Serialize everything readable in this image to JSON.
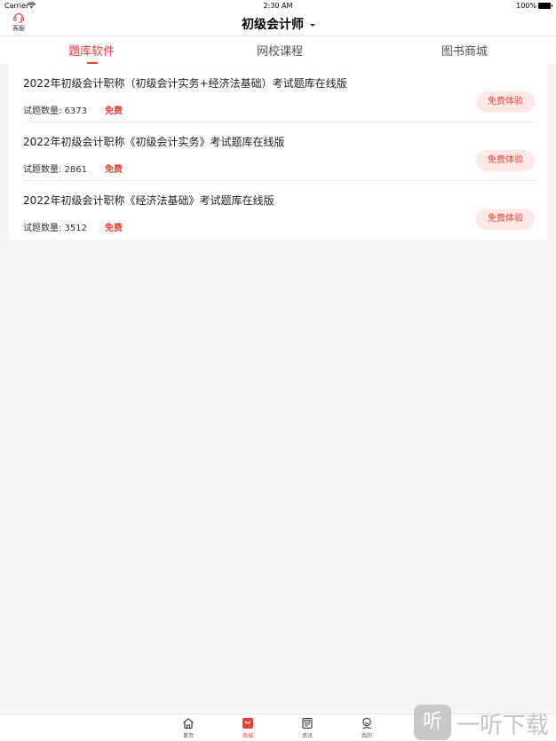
{
  "status_bar": {
    "carrier": "Carrier",
    "time": "2:30 AM",
    "battery": "100%"
  },
  "nav": {
    "service_label": "客服",
    "title": "初级会计师"
  },
  "tabs": [
    {
      "label": "题库软件",
      "active": true
    },
    {
      "label": "网校课程",
      "active": false
    },
    {
      "label": "图书商城",
      "active": false
    }
  ],
  "items": [
    {
      "title": "2022年初级会计职称（初级会计实务+经济法基础）考试题库在线版",
      "count": "试题数量: 6373",
      "free": "免费",
      "button": "免费体验"
    },
    {
      "title": "2022年初级会计职称《初级会计实务》考试题库在线版",
      "count": "试题数量: 2861",
      "free": "免费",
      "button": "免费体验"
    },
    {
      "title": "2022年初级会计职称《经济法基础》考试题库在线版",
      "count": "试题数量: 3512",
      "free": "免费",
      "button": "免费体验"
    }
  ],
  "bottom_nav": [
    {
      "label": "首页",
      "icon": "home-icon",
      "active": false
    },
    {
      "label": "商城",
      "icon": "shop-icon",
      "active": true
    },
    {
      "label": "资讯",
      "icon": "news-icon",
      "active": false
    },
    {
      "label": "我的",
      "icon": "profile-icon",
      "active": false
    }
  ],
  "watermark": {
    "logo_char": "听",
    "text": "一听下载"
  },
  "colors": {
    "accent": "#e8423a",
    "button_bg": "#fde8e6",
    "background": "#f5f5f5"
  }
}
